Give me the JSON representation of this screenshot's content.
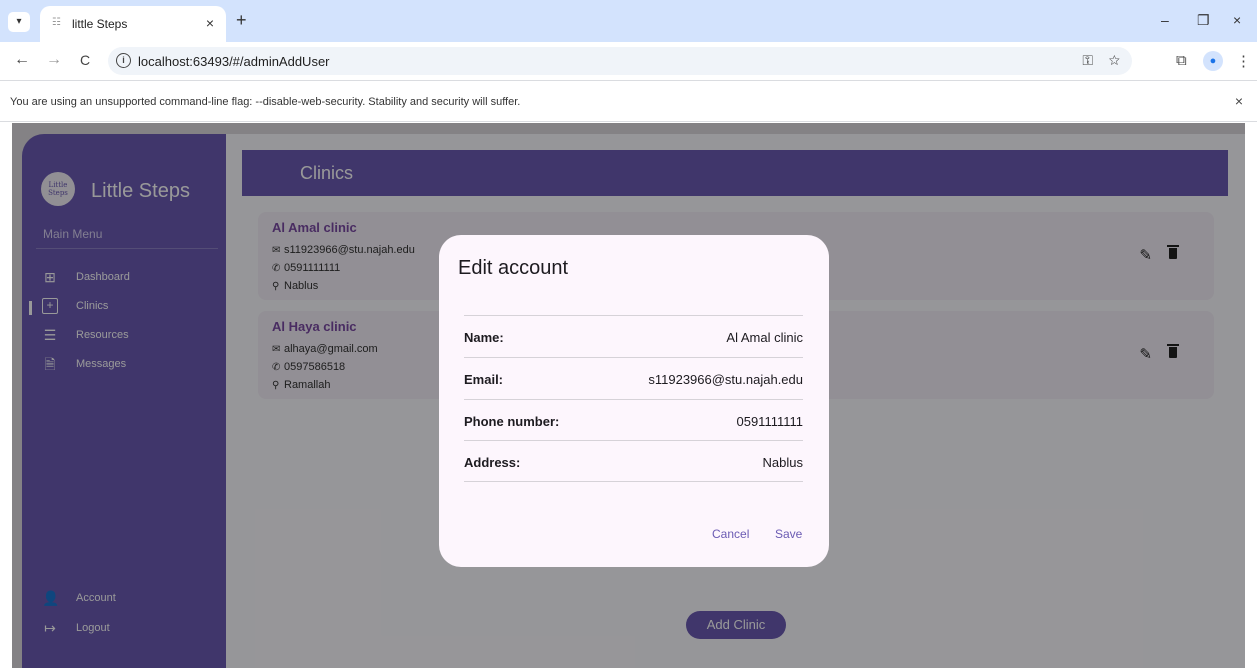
{
  "browser": {
    "tab_menu_icon": "chevron-down",
    "tab_title": "little Steps",
    "tab_close": "×",
    "new_tab": "+",
    "win_min": "–",
    "win_max": "❐",
    "win_close": "×",
    "back": "←",
    "forward": "→",
    "reload": "C",
    "info": "i",
    "url": "localhost:63493/#/adminAddUser",
    "key_icon": "⚿",
    "star_icon": "☆",
    "extensions_icon": "⧉",
    "profile_icon": "person",
    "menu_icon": "⋮",
    "infobar_text": "You are using an unsupported command-line flag: --disable-web-security. Stability and security will suffer.",
    "infobar_close": "×"
  },
  "sidebar": {
    "logo_line1": "Little",
    "logo_line2": "Steps",
    "brand": "Little Steps",
    "menu_title": "Main Menu",
    "items": [
      {
        "label": "Dashboard",
        "icon": "⊞"
      },
      {
        "label": "Clinics",
        "icon": "⊞"
      },
      {
        "label": "Resources",
        "icon": "☰"
      },
      {
        "label": "Messages",
        "icon": "🗎"
      }
    ],
    "bottom_items": [
      {
        "label": "Account",
        "icon": "👤"
      },
      {
        "label": "Logout",
        "icon": "↦"
      }
    ]
  },
  "main": {
    "title": "Clinics",
    "clinics": [
      {
        "name": "Al Amal clinic",
        "email": "s11923966@stu.najah.edu",
        "phone": "0591111111",
        "address": "Nablus"
      },
      {
        "name": "Al Haya clinic",
        "email": "alhaya@gmail.com",
        "phone": "0597586518",
        "address": "Ramallah"
      }
    ],
    "edit_icon": "✎",
    "add_button": "Add Clinic"
  },
  "dialog": {
    "title": "Edit account",
    "fields": [
      {
        "label": "Name:",
        "value": "Al Amal clinic"
      },
      {
        "label": "Email:",
        "value": "s11923966@stu.najah.edu"
      },
      {
        "label": "Phone number:",
        "value": "0591111111"
      },
      {
        "label": "Address:",
        "value": "Nablus"
      }
    ],
    "cancel": "Cancel",
    "save": "Save"
  },
  "colors": {
    "primary": "#6b5bb3",
    "clinic_name": "#7a4aa3",
    "dialog_bg": "#fdf6fd",
    "tabbar": "#d3e3fd"
  }
}
